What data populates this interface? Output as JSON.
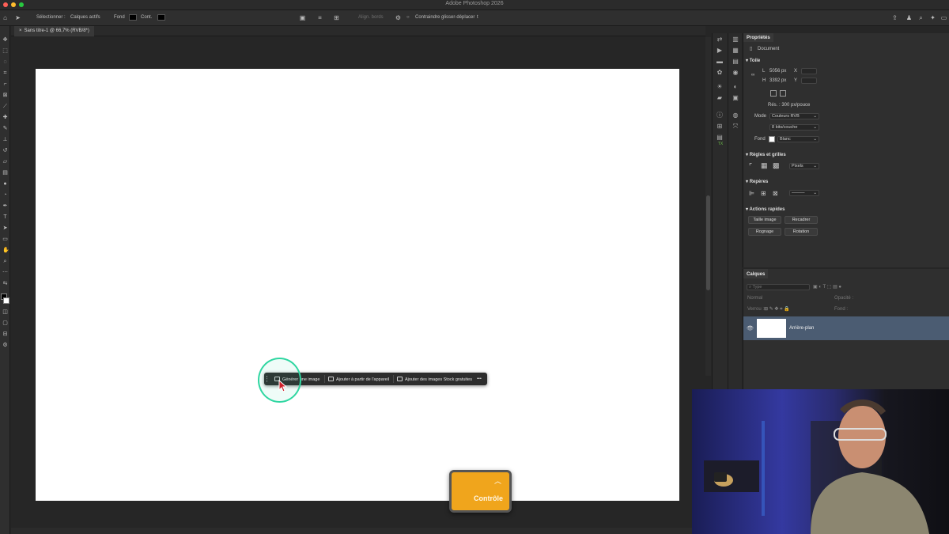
{
  "app": {
    "title": "Adobe Photoshop 2026"
  },
  "options_bar": {
    "select_label": "Sélectionner :",
    "select_value": "Calques actifs",
    "fill_label": "Fond",
    "stroke_label": "Cont.",
    "align_edges": "Align. bords",
    "constrain_label": "Contraindre glisser-déplacer",
    "constrain_value": "t"
  },
  "document": {
    "tab_title": "Sans titre-1 @ 66,7% (RVB/8*)"
  },
  "contextual_taskbar": {
    "generate": "Générer une image",
    "add_from_device": "Ajouter à partir de l'appareil",
    "add_stock": "Ajouter des images Stock gratuites",
    "more": "•••"
  },
  "properties": {
    "tab": "Propriétés",
    "kind": "Document",
    "canvas_section": "Toile",
    "w_label": "L",
    "w_value": "5056 px",
    "h_label": "H",
    "h_value": "3392 px",
    "x_label": "X",
    "y_label": "Y",
    "resolution": "Rés. : 300 px/pouce",
    "mode_label": "Mode",
    "mode_value": "Couleurs RVB",
    "depth_value": "8 bits/couche",
    "fill_label": "Fond",
    "fill_value": "Blanc",
    "rulers_section": "Règles et grilles",
    "units_value": "Pixels",
    "guides_section": "Repères",
    "quick_actions_section": "Actions rapides",
    "btn_image_size": "Taille image",
    "btn_crop": "Recadrer",
    "btn_trim": "Rognage",
    "btn_rotate": "Rotation",
    "color_fill_white": "#ffffff"
  },
  "layers": {
    "tab": "Calques",
    "search_placeholder": "Type",
    "blend_mode": "Normal",
    "opacity_label": "Opacité :",
    "lock_label": "Verrou :",
    "fill_label": "Fond :",
    "layer_name": "Arrière-plan"
  },
  "overlay": {
    "control_label": "Contrôle",
    "control_color": "#f0a51c"
  },
  "colors": {
    "click_ring": "#2fd6a1",
    "selected_layer": "#4b5c72"
  }
}
